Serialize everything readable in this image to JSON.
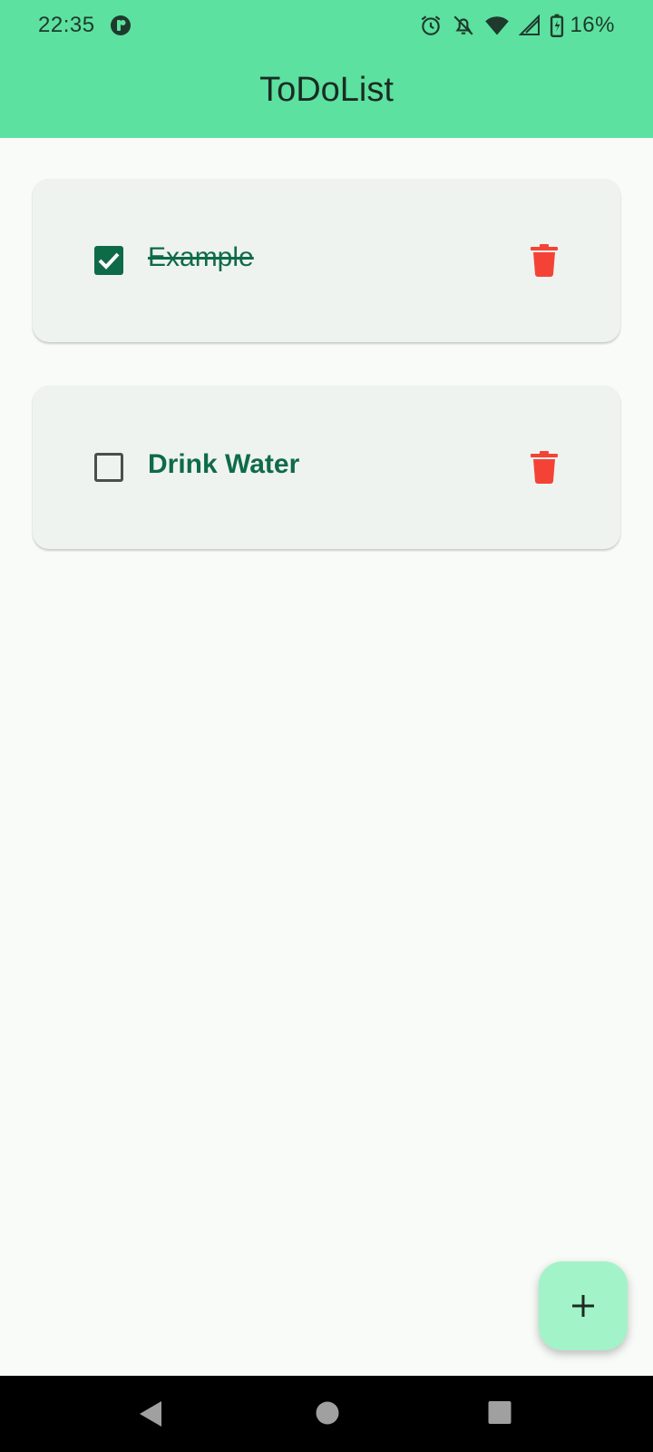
{
  "status_bar": {
    "time": "22:35",
    "battery": "16%",
    "icons": [
      "app-notification-icon",
      "alarm-icon",
      "notifications-off-icon",
      "wifi-icon",
      "cell-signal-icon",
      "battery-charging-icon"
    ]
  },
  "app_bar": {
    "title": "ToDoList",
    "color": "#5ce1a0"
  },
  "tasks": [
    {
      "label": "Example",
      "done": true
    },
    {
      "label": "Drink Water",
      "done": false
    }
  ],
  "fab": {
    "icon": "add-icon",
    "color": "#a3f3c8"
  },
  "colors": {
    "accent": "#0e6b47",
    "delete": "#f44336",
    "card": "#eef3ef",
    "background": "#f9fbf8"
  },
  "nav_bar": {
    "icons": [
      "back-icon",
      "home-icon",
      "recents-icon"
    ]
  }
}
